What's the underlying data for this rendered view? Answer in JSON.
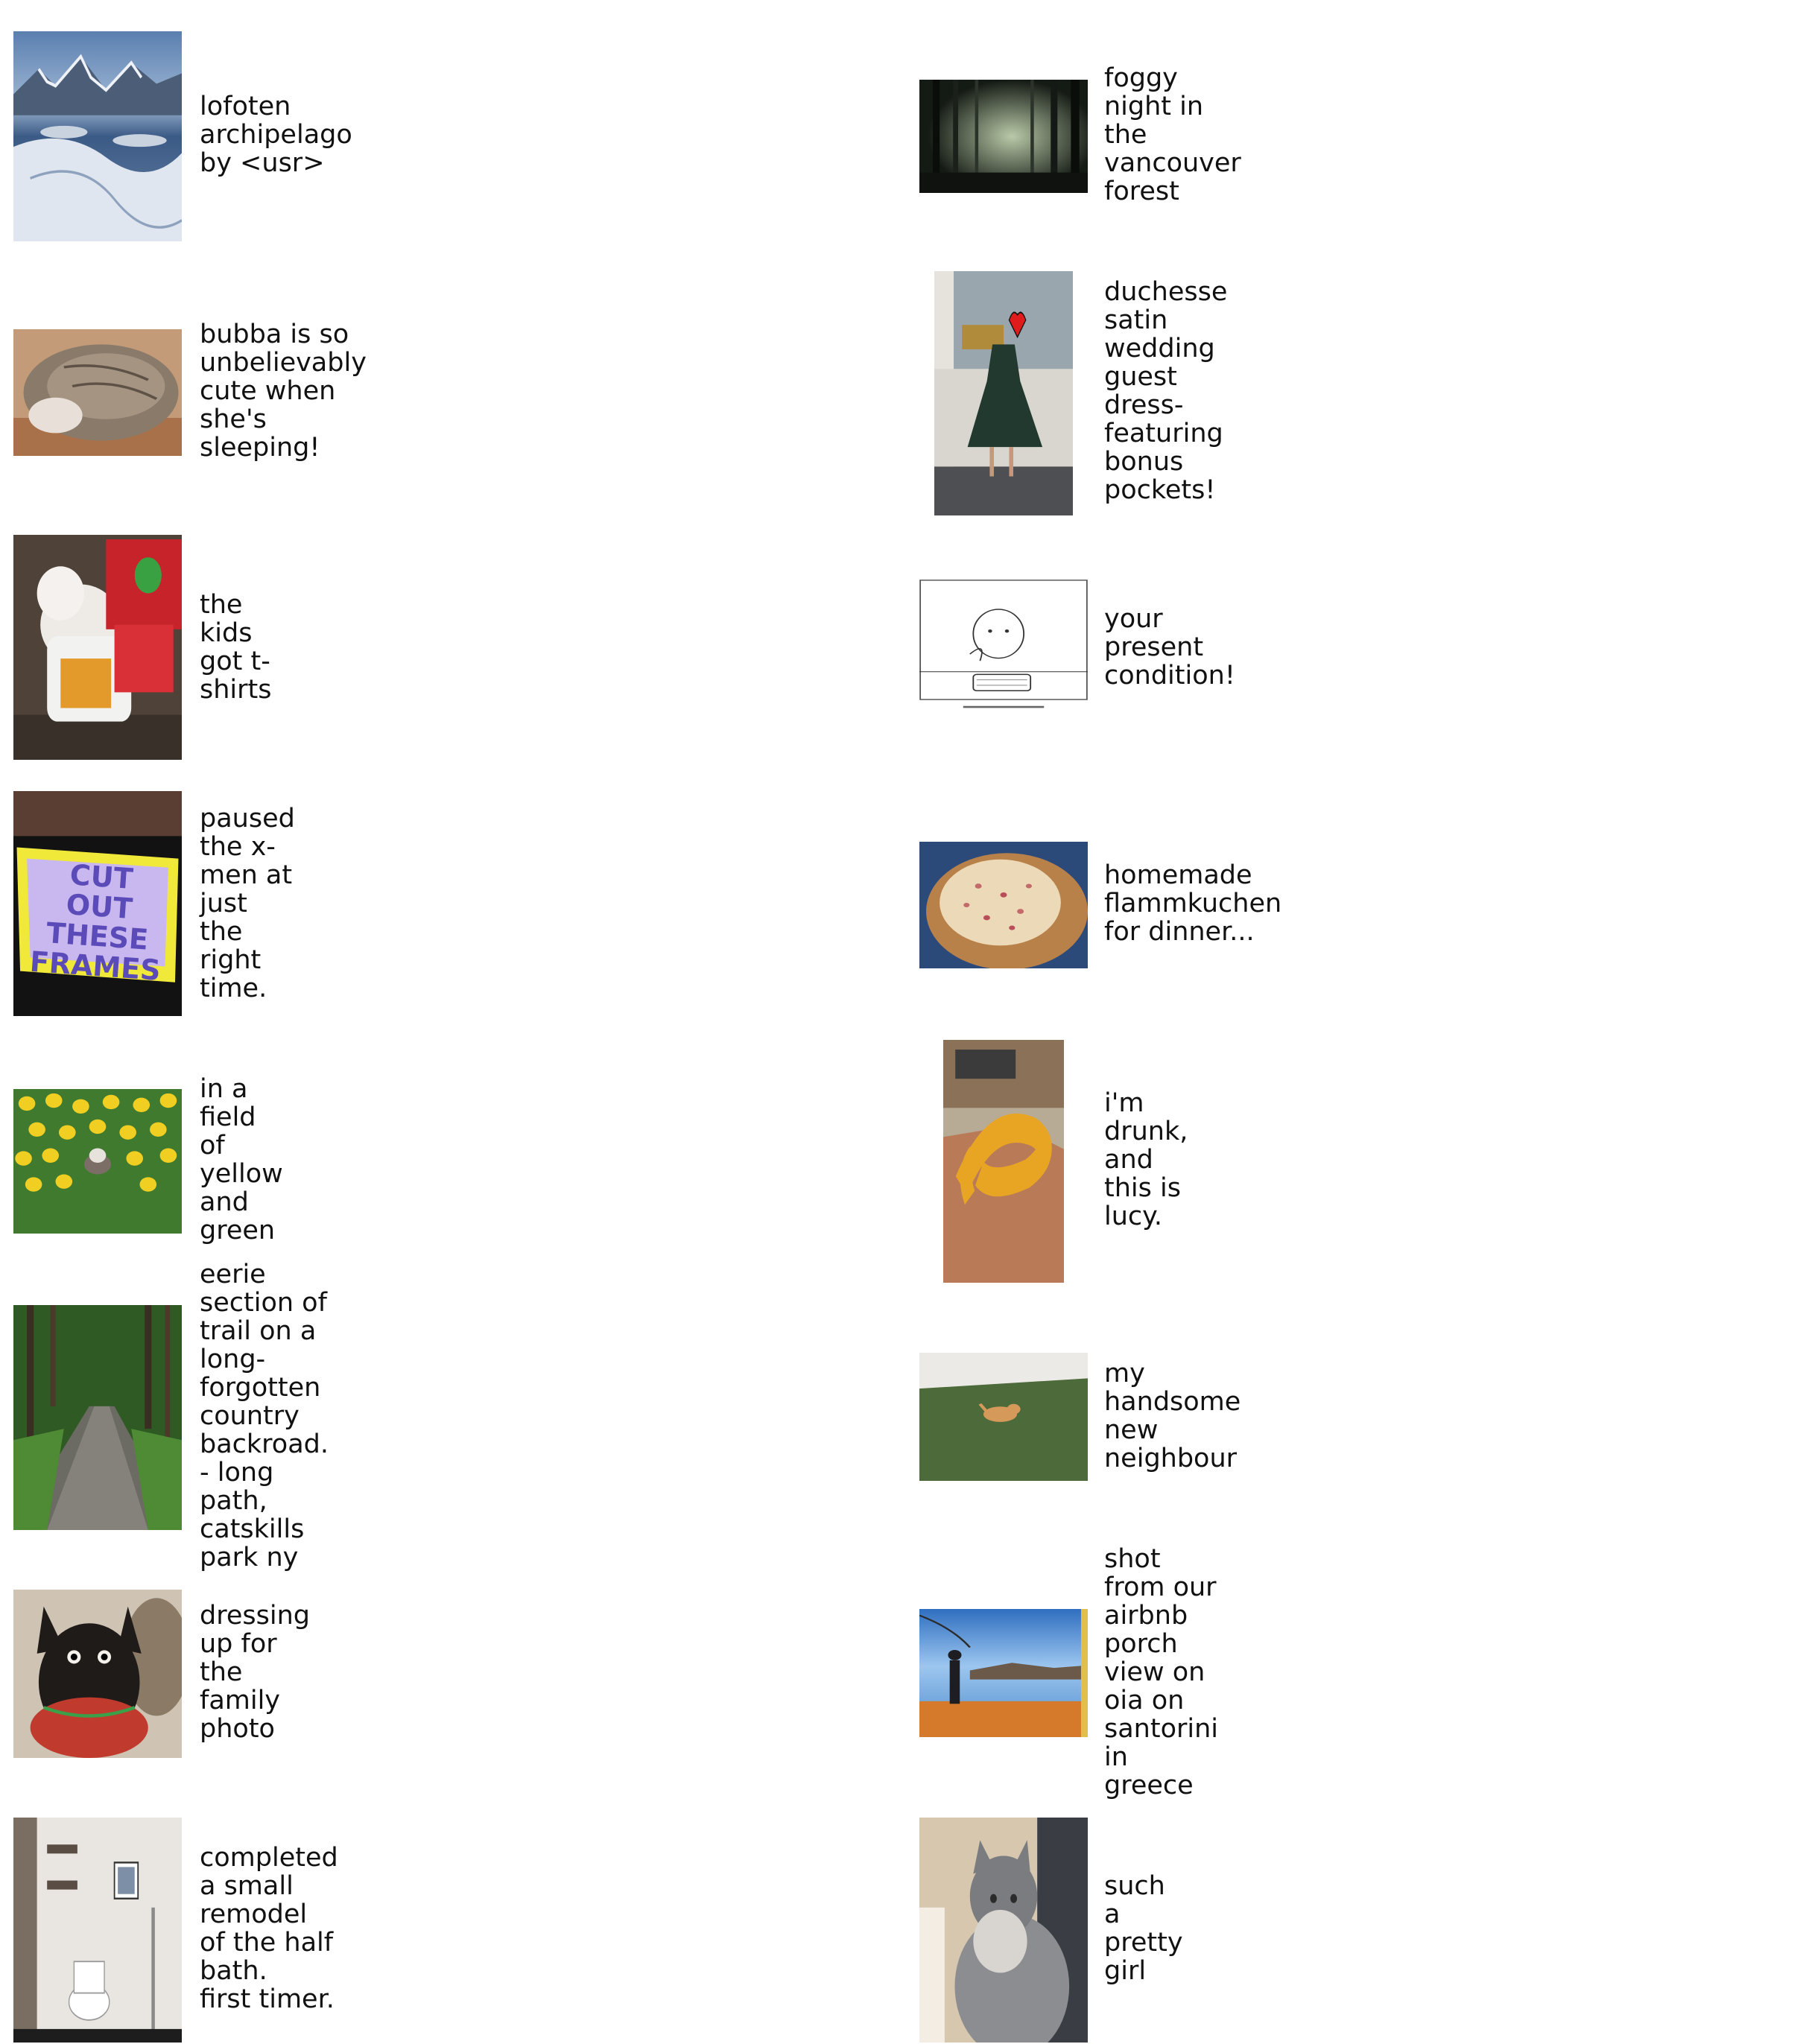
{
  "items": [
    {
      "caption": "lofoten archipelago by <usr>",
      "photo": "snowy-mountain-archipelago-photo"
    },
    {
      "caption": "foggy night in the vancouver forest",
      "photo": "foggy-forest-photo"
    },
    {
      "caption": "bubba is so unbelievably cute when she's\nsleeping!",
      "photo": "sleeping-cat-photo"
    },
    {
      "caption": "duchesse satin wedding guest dress-\nfeaturing bonus pockets!",
      "photo": "green-dress-photo"
    },
    {
      "caption": "the kids got t-shirts",
      "photo": "dog-in-tshirt-photo"
    },
    {
      "caption": "your present condition!",
      "photo": "cartoon-keyboard-drawing"
    },
    {
      "caption": "paused the x-men at just the right time.",
      "photo": "tv-sign-photo"
    },
    {
      "caption": "homemade flammkuchen for dinner...",
      "photo": "flatbread-photo"
    },
    {
      "caption": "in a field of yellow and green",
      "photo": "yellow-flower-field-photo"
    },
    {
      "caption": "i'm drunk, and this is lucy.",
      "photo": "snake-on-hand-photo"
    },
    {
      "caption": "eerie section of trail on a long-forgotten\ncountry backroad. - long path, catskills\npark ny",
      "photo": "forest-trail-photo"
    },
    {
      "caption": "my handsome new neighbour",
      "photo": "small-animal-on-grass-photo"
    },
    {
      "caption": "dressing up for the family photo",
      "photo": "small-dog-in-sweater-photo"
    },
    {
      "caption": "shot from our airbnb porch view on oia on\nsantorini in greece",
      "photo": "santorini-view-photo"
    },
    {
      "caption": "completed a small remodel of the half bath.\nfirst timer.",
      "photo": "half-bathroom-photo"
    },
    {
      "caption": "such a pretty girl",
      "photo": "fluffy-gray-cat-photo"
    }
  ],
  "sign_text": "CUT OUT THESE FRAMES"
}
